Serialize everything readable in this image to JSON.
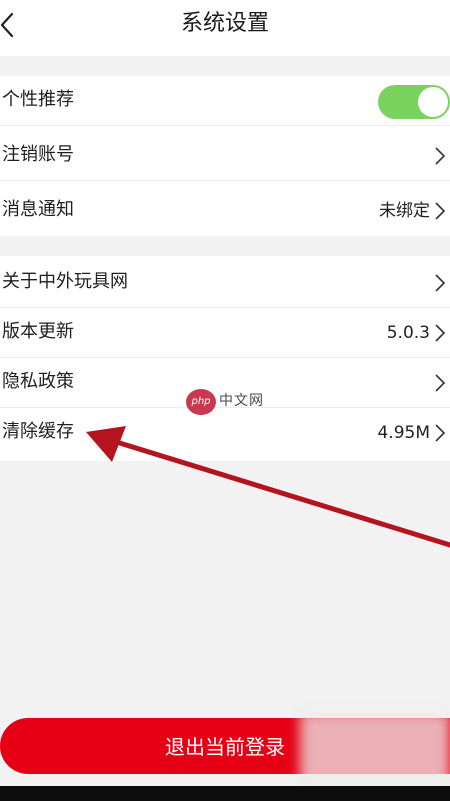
{
  "header": {
    "title": "系统设置",
    "back_icon": "chevron-left-icon"
  },
  "settings_group_1": {
    "items": [
      {
        "label": "个性推荐",
        "control": "toggle",
        "toggle_on": true
      },
      {
        "label": "注销账号",
        "value": ""
      },
      {
        "label": "消息通知",
        "value": "未绑定"
      }
    ]
  },
  "settings_group_2": {
    "items": [
      {
        "label": "关于中外玩具网",
        "value": ""
      },
      {
        "label": "版本更新",
        "value": "5.0.3"
      },
      {
        "label": "隐私政策",
        "value": ""
      },
      {
        "label": "清除缓存",
        "value": "4.95M"
      }
    ]
  },
  "watermark": {
    "logo_text": "php",
    "text": "中文网"
  },
  "logout_button": {
    "label": "退出当前登录"
  },
  "colors": {
    "accent_red": "#e50016",
    "toggle_green": "#7bd35f",
    "background": "#f2f2f2",
    "annotation_arrow": "#b3141e"
  }
}
